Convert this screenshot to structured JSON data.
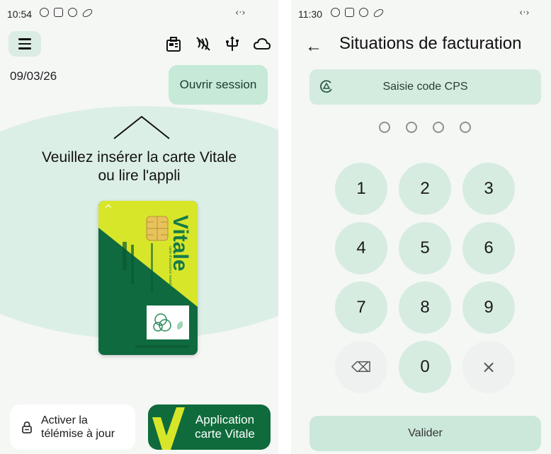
{
  "left": {
    "status": {
      "time": "10:54",
      "net": "‹·›"
    },
    "date": "09/03/26",
    "open_session_label": "Ouvrir session",
    "instruction": {
      "line1": "Veuillez insérer la carte Vitale",
      "line2": "ou lire l'appli"
    },
    "card": {
      "brand": "Vitale",
      "subtitle": "carte d'assurance maladie",
      "caret": "^"
    },
    "bottom_left": {
      "line1": "Activer la",
      "line2": "télémise à jour"
    },
    "bottom_right": {
      "line1": "Application",
      "line2": "carte Vitale"
    },
    "top_icons": [
      "card-reader-icon",
      "contactless-off-icon",
      "usb-icon",
      "cloud-icon"
    ],
    "menu_icon": "hamburger-menu-icon"
  },
  "right": {
    "status": {
      "time": "11:30",
      "net": "‹·›"
    },
    "back_icon": "←",
    "title": "Situations de facturation",
    "cps_field_label": "Saisie code CPS",
    "pin_length": 4,
    "keys": [
      "1",
      "2",
      "3",
      "4",
      "5",
      "6",
      "7",
      "8",
      "9",
      "⌫",
      "0",
      "×"
    ],
    "validate_label": "Valider"
  },
  "colors": {
    "accent_green": "#0f6b3c",
    "light_green": "#c6e9d8",
    "vitale_yellow": "#d8e62a",
    "background": "#f5f7f5"
  }
}
